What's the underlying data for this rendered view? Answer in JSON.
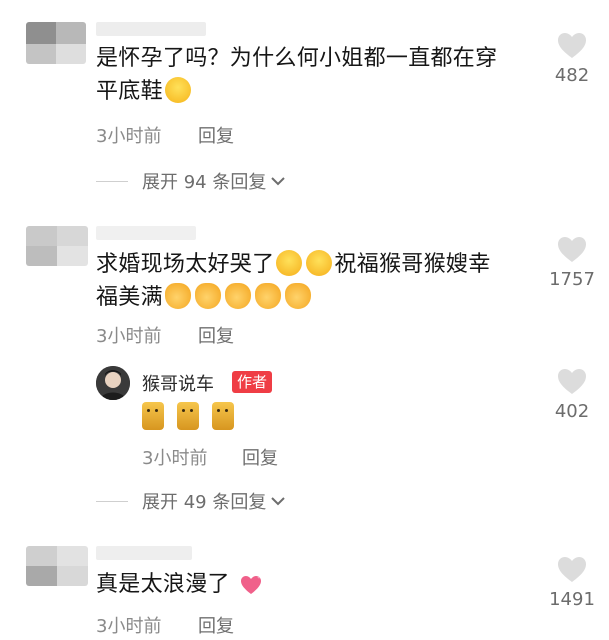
{
  "comments": [
    {
      "text_line1": "是怀孕了吗？为什么何小姐都一直都在穿",
      "text_line2": "平底鞋",
      "time": "3小时前",
      "reply_label": "回复",
      "likes": "482",
      "expand_label": "展开 94 条回复"
    },
    {
      "text_line1": "求婚现场太好哭了",
      "text_line1b": "祝福猴哥猴嫂幸",
      "text_line2": "福美满",
      "time": "3小时前",
      "reply_label": "回复",
      "likes": "1757",
      "reply": {
        "author": "猴哥说车",
        "badge": "作者",
        "time": "3小时前",
        "reply_label": "回复",
        "likes": "402"
      },
      "expand_label": "展开 49 条回复"
    },
    {
      "text": "真是太浪漫了",
      "time": "3小时前",
      "reply_label": "回复",
      "likes": "1491"
    }
  ],
  "icons": {
    "like": "heart-outline-icon",
    "expand": "chevron-down-icon"
  },
  "colors": {
    "author_badge": "#ef3d45",
    "heart": "#d6d6d6"
  }
}
